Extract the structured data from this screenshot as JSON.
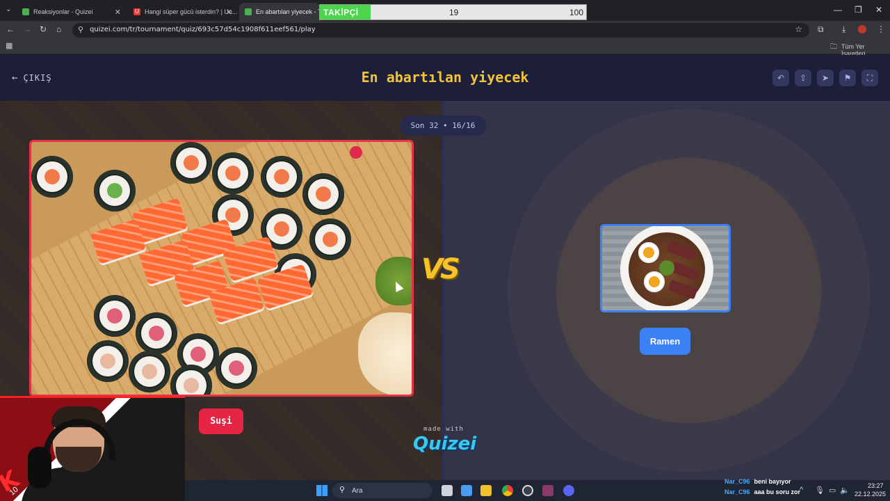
{
  "browser": {
    "tabs": [
      {
        "title": "Reaksiyonlar - Quizei",
        "favicon_color": "#4caf50"
      },
      {
        "title": "Hangi süper gücü isterdin? | Un...",
        "favicon_color": "#e53935",
        "favicon_letter": "U"
      },
      {
        "title": "En abartılan yiyecek - Tier L",
        "favicon_color": "#4caf50"
      }
    ],
    "url": "quizei.com/tr/tournament/quiz/693c57d54c1908f611eef561/play",
    "bookmarks_label": "Tüm Yer İşaretleri"
  },
  "overlay": {
    "follower_label": "TAKİPÇİ",
    "follower_current": 19,
    "follower_goal": 100
  },
  "quiz": {
    "exit_label": "ÇIKIŞ",
    "title": "En abartılan yiyecek",
    "round_label": "Son 32 • 16/16",
    "left": {
      "name": "Suşi",
      "color": "#e62544"
    },
    "right": {
      "name": "Ramen",
      "color": "#3b82f6"
    },
    "vs_label": "VS",
    "made_with": "made with",
    "brand": "Quizei",
    "header_icons": [
      "undo-icon",
      "share-icon",
      "send-icon",
      "flag-icon",
      "fullscreen-icon"
    ]
  },
  "webcam": {
    "overlay_number": "10"
  },
  "taskbar": {
    "search_placeholder": "Ara",
    "chat": [
      {
        "user": "Nar_C96",
        "message": "beni bayıyor"
      },
      {
        "user": "Nar_C96",
        "message": "aaa bu soru zor"
      }
    ],
    "time": "23:27",
    "date": "22.12.2025"
  }
}
